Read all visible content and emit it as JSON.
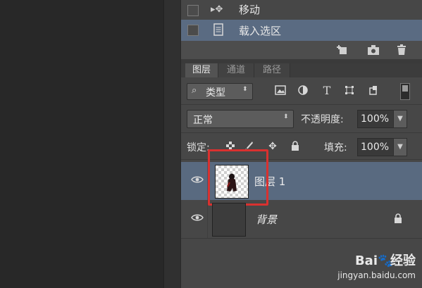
{
  "actions_panel": {
    "items": [
      {
        "label": "移动",
        "icon": "move-icon",
        "selected": false
      },
      {
        "label": "载入选区",
        "icon": "document-icon",
        "selected": true
      }
    ],
    "footer_icons": [
      "new-action-icon",
      "camera-icon",
      "trash-icon"
    ]
  },
  "layers_panel": {
    "tabs": [
      "图层",
      "通道",
      "路径"
    ],
    "active_tab": "图层",
    "filter": {
      "label": "类型",
      "icons": [
        "image-filter-icon",
        "adjustment-filter-icon",
        "type-filter-icon",
        "shape-filter-icon",
        "smart-object-filter-icon"
      ]
    },
    "blend_mode": "正常",
    "opacity_label": "不透明度:",
    "opacity_value": "100%",
    "lock_label": "锁定:",
    "lock_icons": [
      "lock-transparent-icon",
      "lock-paint-icon",
      "lock-position-icon",
      "lock-all-icon"
    ],
    "fill_label": "填充:",
    "fill_value": "100%",
    "layers": [
      {
        "name": "图层 1",
        "visible": true,
        "selected": true,
        "thumbnail": "checkerboard-with-figure",
        "highlighted": true
      },
      {
        "name": "背景",
        "visible": true,
        "selected": false,
        "thumbnail": "dark",
        "locked": true
      }
    ]
  },
  "watermark": {
    "brand_left": "Bai",
    "brand_right": "经验",
    "url": "jingyan.baidu.com"
  },
  "colors": {
    "selection": "#596a80",
    "panel_bg": "#474747",
    "highlight_box": "#d9312f"
  }
}
